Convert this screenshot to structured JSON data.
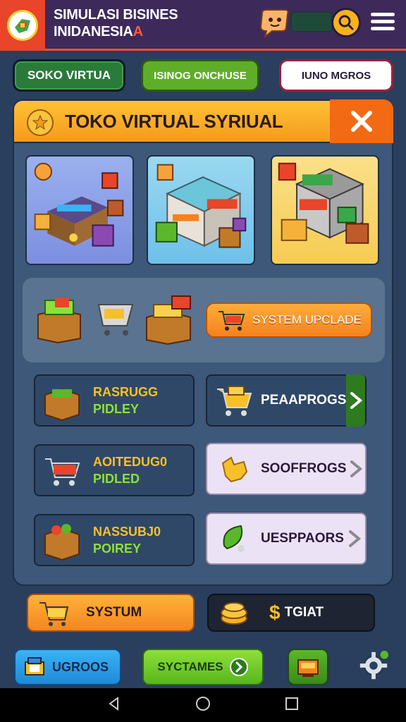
{
  "header": {
    "title_line1": "SIMULASI BISINES",
    "title_line2": "INIDANESIA",
    "title_accent": "A",
    "icons": [
      "logo-icon",
      "chat-icon",
      "search-icon",
      "menu-icon"
    ]
  },
  "tabs": [
    {
      "label": "SOKO VIRTUA"
    },
    {
      "label": "ISINOG ONCHUSE"
    },
    {
      "label": "IUNO MGROS"
    }
  ],
  "panel": {
    "title": "TOKO VIRTUAL SYRIUAL",
    "close_icon": "close-icon",
    "stores": [
      {
        "name": "store-kiosk"
      },
      {
        "name": "store-supermarket"
      },
      {
        "name": "store-market"
      }
    ],
    "upgrade_button": "SYSTEM UPCLADE",
    "items": [
      {
        "line1": "RASRUGG",
        "line2": "PIDLEY"
      },
      {
        "label": "PEAAPROGS"
      },
      {
        "line1": "AOITEDUG0",
        "line2": "PIDLED"
      },
      {
        "label": "SOOFFROGS"
      },
      {
        "line1": "NASSUBJ0",
        "line2": "POIREY"
      },
      {
        "label": "UESPPAORS"
      }
    ]
  },
  "bottom": {
    "system_label": "SYSTUM",
    "total_label": "TGIAT",
    "total_symbol": "$"
  },
  "nav": {
    "btn1": "UGROOS",
    "btn2": "SYCTAMES"
  },
  "colors": {
    "header_bg": "#3d2a5a",
    "accent_orange": "#f59a1e",
    "panel_bg": "#3d5878",
    "gold_text": "#f7c02a",
    "green_text": "#8ee03a"
  }
}
